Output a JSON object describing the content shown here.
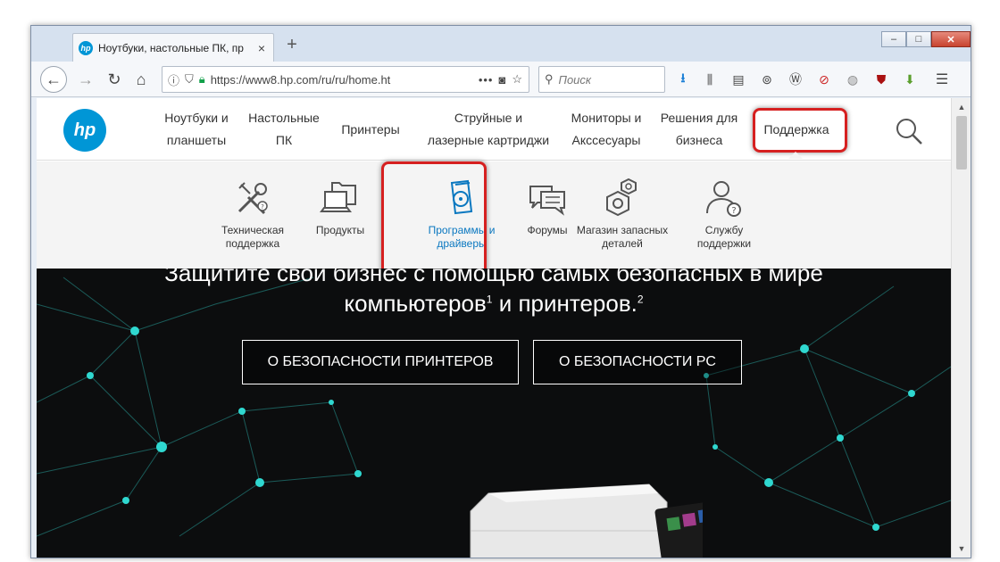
{
  "browser": {
    "tab_title": "Ноутбуки, настольные ПК, пр",
    "tab_close": "×",
    "new_tab": "+",
    "url": "https://www8.hp.com/ru/ru/home.ht",
    "url_more": "•••",
    "search_placeholder": "Поиск",
    "window_controls": {
      "minimize": "‒",
      "maximize": "□",
      "close": "✕"
    }
  },
  "site": {
    "logo_text": "hp",
    "menu": [
      {
        "label": "Ноутбуки и\nпланшеты"
      },
      {
        "label": "Настольные\nПК"
      },
      {
        "label": "Принтеры"
      },
      {
        "label": "Струйные и\nлазерные картриджи"
      },
      {
        "label": "Мониторы и\nАкссесуары"
      },
      {
        "label": "Решения для\nбизнеса"
      },
      {
        "label": "Поддержка"
      }
    ],
    "submenu": [
      {
        "label": "Техническая\nподдержка",
        "icon": "tools-icon"
      },
      {
        "label": "Продукты",
        "icon": "laptop-folder-icon"
      },
      {
        "label": "Программы и\nдрайверы",
        "icon": "software-disc-icon"
      },
      {
        "label": "Форумы",
        "icon": "chat-bubbles-icon"
      },
      {
        "label": "Магазин запасных\nдеталей",
        "icon": "parts-hexagon-icon"
      },
      {
        "label": "Службу\nподдержки",
        "icon": "support-person-icon"
      }
    ],
    "hero": {
      "line1": "Защитите свой бизнес с помощью самых безопасных в мире",
      "line2_a": "компьютеров",
      "line2_sup1": "1",
      "line2_b": " и принтеров.",
      "line2_sup2": "2",
      "button_printers": "О БЕЗОПАСНОСТИ ПРИНТЕРОВ",
      "button_pc": "О БЕЗОПАСНОСТИ PC"
    }
  },
  "colors": {
    "hp_blue": "#0096d6",
    "highlight_red": "#d62020",
    "network_cyan": "#2fd8d0"
  }
}
